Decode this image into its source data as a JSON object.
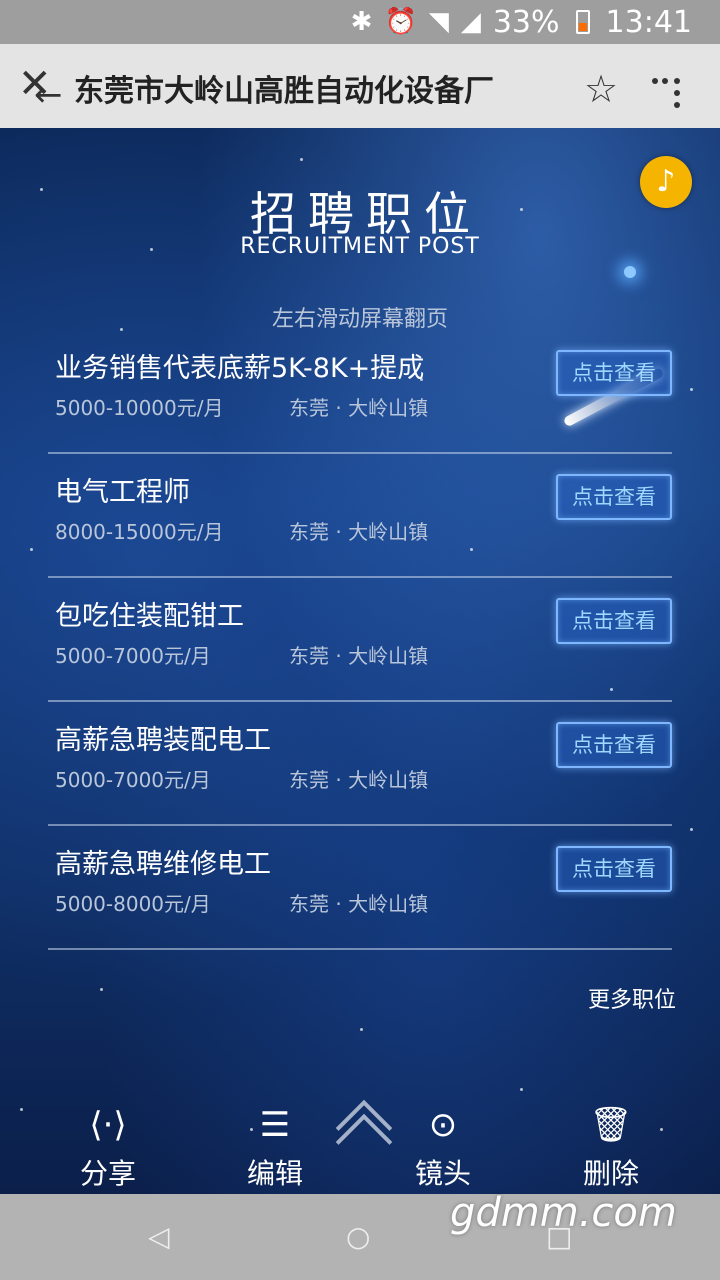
{
  "status_bar": {
    "battery": "33%",
    "time": "13:41"
  },
  "titlebar": {
    "title": "东莞市大岭山高胜自动化设备厂"
  },
  "page": {
    "heading": "招聘职位",
    "subheading": "RECRUITMENT POST",
    "hint": "左右滑动屏幕翻页",
    "more_label": "更多职位"
  },
  "jobs": [
    {
      "title": "业务销售代表底薪5K-8K+提成",
      "salary": "5000-10000元/月",
      "location": "东莞 · 大岭山镇",
      "button": "点击查看"
    },
    {
      "title": "电气工程师",
      "salary": "8000-15000元/月",
      "location": "东莞 · 大岭山镇",
      "button": "点击查看"
    },
    {
      "title": "包吃住装配钳工",
      "salary": "5000-7000元/月",
      "location": "东莞 · 大岭山镇",
      "button": "点击查看"
    },
    {
      "title": "高薪急聘装配电工",
      "salary": "5000-7000元/月",
      "location": "东莞 · 大岭山镇",
      "button": "点击查看"
    },
    {
      "title": "高薪急聘维修电工",
      "salary": "5000-8000元/月",
      "location": "东莞 · 大岭山镇",
      "button": "点击查看"
    }
  ],
  "toolbar": {
    "share": "分享",
    "edit": "编辑",
    "lens": "镜头",
    "delete": "删除"
  },
  "watermark": "gdmm.com",
  "colors": {
    "music_button": "#f5b400",
    "button_glow": "#7fb7ff"
  }
}
